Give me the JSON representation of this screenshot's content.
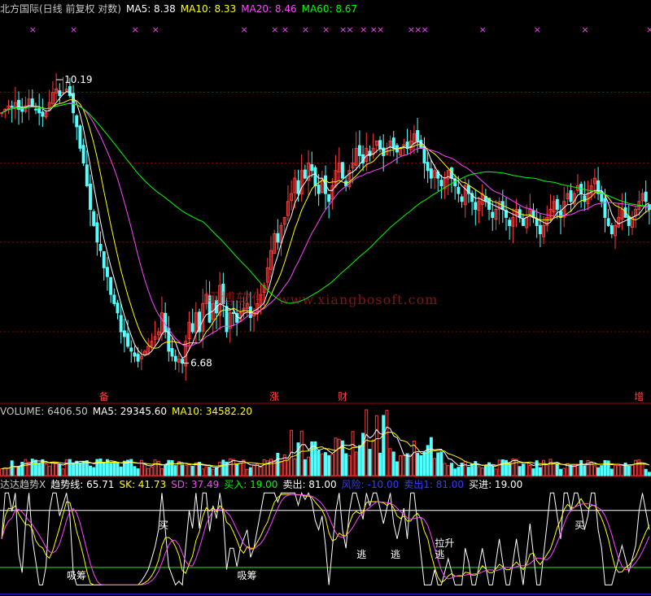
{
  "colors": {
    "up": "#ff3c3c",
    "down": "#54ffff",
    "ma5": "#ffffff",
    "ma10": "#ffff00",
    "ma20": "#ff44ff",
    "ma60": "#00ff00",
    "grid": "#8b0000",
    "sk": "#ffff00",
    "sd": "#ff44ff",
    "trend": "#ffffff",
    "buy": "#00ff00",
    "sell": "#ffffff",
    "risk": "#2a2aff"
  },
  "header": {
    "main": {
      "title": "北方国际(日线 前复权 对数)",
      "ma5_label": "MA5: 8.38",
      "ma10_label": "MA10: 8.33",
      "ma20_label": "MA20: 8.46",
      "ma60_label": "MA60: 8.67"
    },
    "volume": {
      "vol_label": "VOLUME: 6406.50",
      "ma5_label": "MA5: 29345.60",
      "ma10_label": "MA10: 34582.20"
    },
    "indicator": {
      "name": "达达趋势X",
      "trend_label": "趋势线: 65.71",
      "sk_label": "SK: 41.73",
      "sd_label": "SD: 37.49",
      "buy_label": "买入: 19.00",
      "sell_label": "卖出: 81.00",
      "risk_label": "风险: -10.00",
      "sellout_label": "卖出1: 81.00",
      "buyin_label": "买进: 19.00"
    }
  },
  "watermark": {
    "text": "翔博软件",
    "url": "www.xiangbosoft.com"
  },
  "chart_data": [
    {
      "type": "candlestick",
      "title": "北方国际(日线 前复权 对数)",
      "ylim": [
        6.3,
        11.2
      ],
      "scale": "log",
      "grid": true,
      "annotations": [
        {
          "text": "10.19",
          "x": 16,
          "y": 10.19
        },
        {
          "text": "6.68",
          "x": 53,
          "y": 6.68
        }
      ],
      "event_marks": [
        {
          "x": 30,
          "text": "备"
        },
        {
          "x": 80,
          "text": "涨"
        },
        {
          "x": 100,
          "text": "财"
        },
        {
          "x": 187,
          "text": "增"
        }
      ],
      "signal_marks": [
        {
          "x": 9,
          "text": "×"
        },
        {
          "x": 21,
          "text": "×"
        },
        {
          "x": 39,
          "text": "×"
        },
        {
          "x": 45,
          "text": "×"
        },
        {
          "x": 71,
          "text": "×"
        },
        {
          "x": 80,
          "text": "×"
        },
        {
          "x": 83,
          "text": "×"
        },
        {
          "x": 89,
          "text": "×"
        },
        {
          "x": 95,
          "text": "×"
        },
        {
          "x": 100,
          "text": "×"
        },
        {
          "x": 102,
          "text": "×"
        },
        {
          "x": 106,
          "text": "×"
        },
        {
          "x": 109,
          "text": "×"
        },
        {
          "x": 111,
          "text": "×"
        },
        {
          "x": 120,
          "text": "×"
        },
        {
          "x": 122,
          "text": "×"
        },
        {
          "x": 124,
          "text": "×"
        },
        {
          "x": 141,
          "text": "×"
        },
        {
          "x": 157,
          "text": "×"
        },
        {
          "x": 171,
          "text": "×"
        },
        {
          "x": 190,
          "text": "×"
        }
      ],
      "ma_series": [
        {
          "name": "MA5",
          "last": 8.38
        },
        {
          "name": "MA10",
          "last": 8.33
        },
        {
          "name": "MA20",
          "last": 8.46
        },
        {
          "name": "MA60",
          "last": 8.67
        }
      ],
      "closes": [
        9.7,
        9.75,
        9.8,
        9.78,
        9.85,
        9.75,
        9.72,
        9.8,
        9.9,
        9.8,
        9.75,
        9.7,
        9.65,
        9.7,
        9.85,
        10.0,
        10.05,
        9.95,
        10.0,
        10.05,
        9.95,
        9.7,
        9.5,
        9.2,
        9.0,
        8.7,
        8.4,
        8.2,
        8.0,
        7.9,
        7.7,
        7.6,
        7.4,
        7.3,
        7.2,
        7.0,
        6.95,
        6.85,
        6.8,
        6.75,
        6.7,
        6.75,
        6.8,
        6.85,
        6.9,
        6.95,
        7.0,
        7.2,
        7.0,
        6.8,
        6.75,
        6.7,
        6.72,
        6.68,
        6.9,
        7.1,
        7.0,
        7.2,
        7.0,
        7.3,
        7.4,
        7.1,
        7.3,
        7.2,
        7.5,
        7.3,
        7.0,
        7.2,
        7.2,
        7.1,
        7.2,
        7.25,
        7.3,
        7.15,
        7.2,
        7.3,
        7.4,
        7.5,
        7.7,
        7.9,
        8.1,
        8.0,
        8.2,
        8.3,
        8.5,
        8.6,
        8.8,
        8.6,
        8.9,
        8.8,
        9.0,
        8.9,
        8.7,
        8.6,
        8.8,
        8.6,
        8.5,
        8.7,
        8.9,
        9.0,
        8.8,
        8.7,
        8.9,
        9.0,
        9.2,
        9.1,
        9.0,
        9.2,
        9.1,
        9.2,
        9.3,
        9.2,
        9.1,
        9.2,
        9.3,
        9.2,
        9.15,
        9.2,
        9.25,
        9.2,
        9.3,
        9.4,
        9.3,
        9.2,
        9.0,
        8.9,
        8.8,
        8.9,
        8.8,
        8.7,
        8.8,
        8.9,
        8.8,
        8.7,
        8.6,
        8.5,
        8.7,
        8.6,
        8.5,
        8.4,
        8.5,
        8.6,
        8.5,
        8.4,
        8.3,
        8.4,
        8.5,
        8.4,
        8.3,
        8.2,
        8.3,
        8.4,
        8.3,
        8.2,
        8.3,
        8.4,
        8.3,
        8.2,
        8.1,
        8.2,
        8.3,
        8.4,
        8.5,
        8.4,
        8.3,
        8.5,
        8.6,
        8.5,
        8.6,
        8.7,
        8.6,
        8.5,
        8.6,
        8.7,
        8.8,
        8.6,
        8.5,
        8.3,
        8.2,
        8.1,
        8.2,
        8.3,
        8.4,
        8.3,
        8.2,
        8.3,
        8.4,
        8.5,
        8.6,
        8.5,
        8.4
      ]
    },
    {
      "type": "bar",
      "title": "VOLUME",
      "ylim": [
        0,
        110000
      ],
      "ma_series": [
        {
          "name": "MA5",
          "last": 29345.6
        },
        {
          "name": "MA10",
          "last": 34582.2
        }
      ],
      "last_value": 6406.5
    },
    {
      "type": "line",
      "title": "达达趋势X",
      "ylim": [
        -12,
        102
      ],
      "reference_lines": [
        {
          "name": "卖出",
          "y": 81
        },
        {
          "name": "买入",
          "y": 19
        },
        {
          "name": "风险",
          "y": -10
        }
      ],
      "last_values": {
        "趋势线": 65.71,
        "SK": 41.73,
        "SD": 37.49
      },
      "labels": [
        {
          "text": "吸筹",
          "x": 21
        },
        {
          "text": "吸筹",
          "x": 71
        },
        {
          "text": "买",
          "x": 48
        },
        {
          "text": "买",
          "x": 170
        },
        {
          "text": "逃",
          "x": 106
        },
        {
          "text": "逃",
          "x": 116
        },
        {
          "text": "逃",
          "x": 129
        },
        {
          "text": "拉升",
          "x": 129
        }
      ]
    }
  ]
}
